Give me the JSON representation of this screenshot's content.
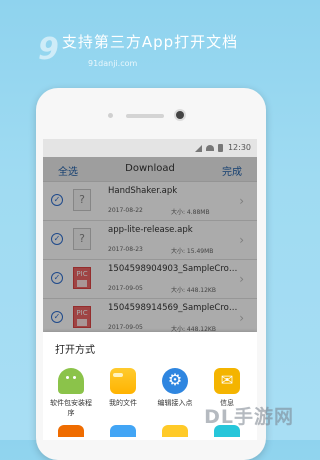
{
  "headline": "支持第三方App打开文档",
  "logo": {
    "big": "9",
    "small": "91danji.com"
  },
  "status": {
    "time": "12:30"
  },
  "titlebar": {
    "left": "全选",
    "title": "Download",
    "right": "完成"
  },
  "files": [
    {
      "icon": "?",
      "type": "unknown",
      "name": "HandShaker.apk",
      "date": "2017-08-22",
      "size": "大小: 4.88MB"
    },
    {
      "icon": "?",
      "type": "unknown",
      "name": "app-lite-release.apk",
      "date": "2017-08-23",
      "size": "大小: 15.49MB"
    },
    {
      "icon": "PIC",
      "type": "image",
      "name": "1504598904903_SampleCro…",
      "date": "2017-09-05",
      "size": "大小: 448.12KB"
    },
    {
      "icon": "PIC",
      "type": "image",
      "name": "1504598914569_SampleCro…",
      "date": "2017-09-05",
      "size": "大小: 448.12KB"
    }
  ],
  "sheet": {
    "title": "打开方式",
    "apps": [
      {
        "label": "软件包安装程序",
        "icon": "android-icon"
      },
      {
        "label": "我的文件",
        "icon": "folder-icon"
      },
      {
        "label": "编辑接入点",
        "icon": "gear-icon"
      },
      {
        "label": "信息",
        "icon": "mail-icon"
      }
    ]
  },
  "watermark": "DL手游网",
  "colors": {
    "accent": "#2f6fd0",
    "background": "#9fdbf2"
  }
}
